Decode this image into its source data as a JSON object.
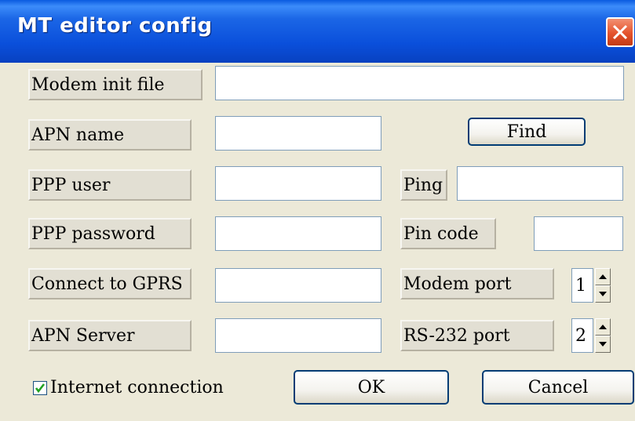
{
  "window": {
    "title": "MT editor config"
  },
  "labels": {
    "modem_init_file": "Modem init file",
    "apn_name": "APN name",
    "ppp_user": "PPP user",
    "ppp_password": "PPP password",
    "connect_to_gprs": "Connect to GPRS",
    "apn_server": "APN Server",
    "ping": "Ping",
    "pin_code": "Pin code",
    "modem_port": "Modem port",
    "rs232_port": "RS-232 port"
  },
  "fields": {
    "modem_init_file": "",
    "apn_name": "",
    "ppp_user": "",
    "ppp_password": "",
    "connect_to_gprs": "",
    "apn_server": "",
    "ping": "",
    "pin_code": ""
  },
  "spinners": {
    "modem_port": "1",
    "rs232_port": "2"
  },
  "buttons": {
    "find": "Find",
    "ok": "OK",
    "cancel": "Cancel"
  },
  "checkbox": {
    "label": "Internet connection",
    "checked": true
  }
}
